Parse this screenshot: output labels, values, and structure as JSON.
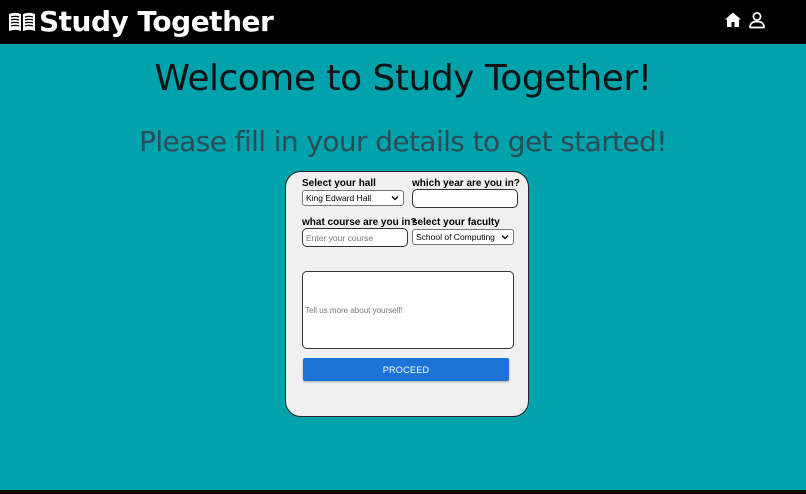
{
  "header": {
    "title": "Study Together",
    "logo_icon": "open-book-icon",
    "nav": [
      {
        "icon": "home-icon"
      },
      {
        "icon": "user-icon"
      }
    ]
  },
  "main": {
    "headline": "Welcome to Study Together!",
    "subheadline": "Please fill in your details to get started!"
  },
  "form": {
    "hall_label": "Select your hall",
    "hall_value": "King Edward Hall",
    "year_label": "which year are you in?",
    "year_value": "",
    "course_label": "what course are you in?",
    "course_placeholder": "Enter your course",
    "faculty_label": "select your faculty",
    "faculty_value": "School of Computing",
    "about_placeholder": "Tell us more about yourself!",
    "proceed_label": "PROCEED"
  },
  "colors": {
    "background": "#00a2ab",
    "header": "#000000",
    "button": "#1c73d6",
    "card": "#f0f0f0"
  }
}
